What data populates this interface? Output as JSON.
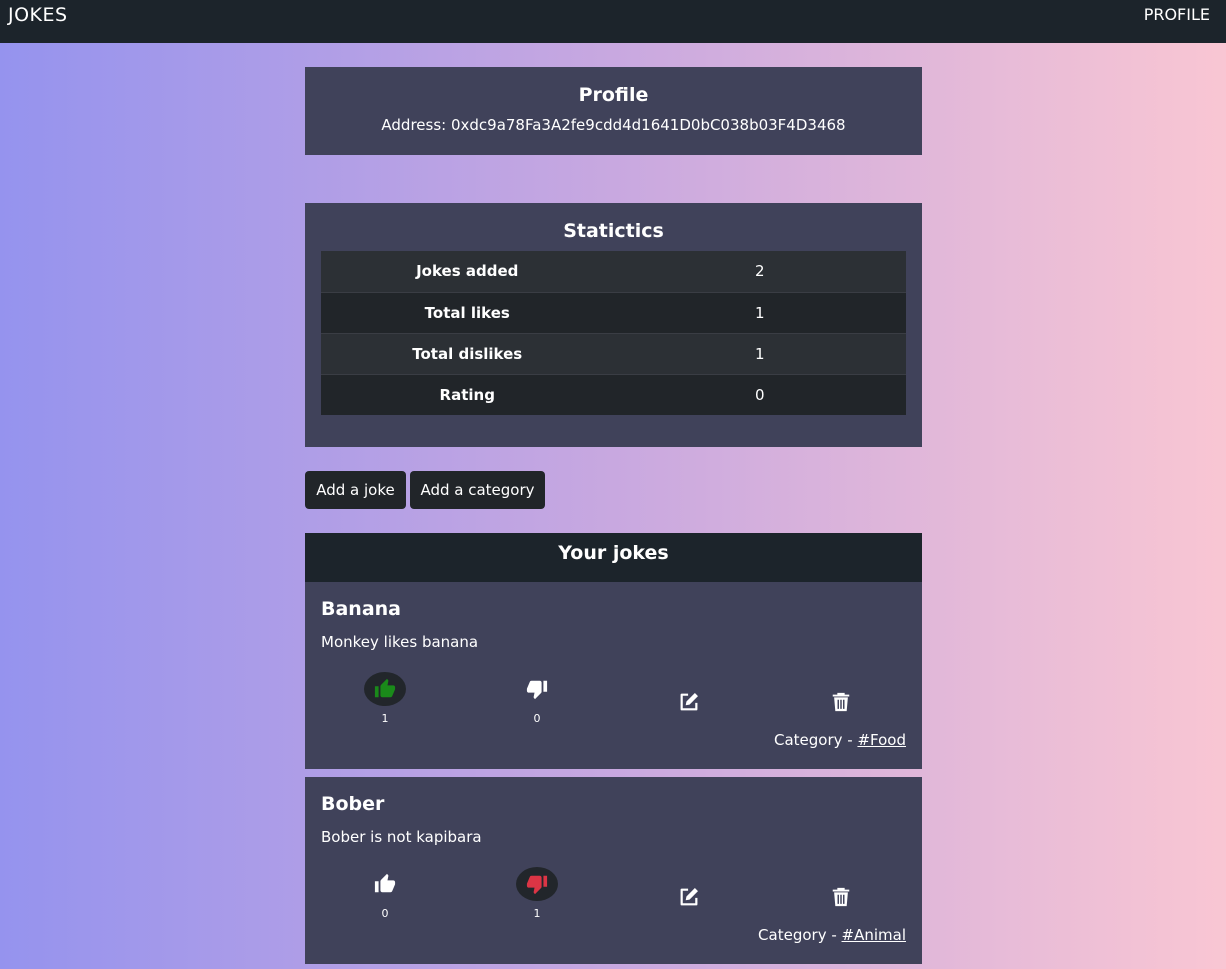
{
  "nav": {
    "brand": "JOKES",
    "profile_link": "PROFILE"
  },
  "profile": {
    "title": "Profile",
    "address": "Address: 0xdc9a78Fa3A2fe9cdd4d1641D0bC038b03F4D3468"
  },
  "statistics": {
    "title": "Statictics",
    "rows": [
      {
        "label": "Jokes added",
        "value": "2"
      },
      {
        "label": "Total likes",
        "value": "1"
      },
      {
        "label": "Total dislikes",
        "value": "1"
      },
      {
        "label": "Rating",
        "value": "0"
      }
    ]
  },
  "actions": {
    "add_joke": "Add a joke",
    "add_category": "Add a category"
  },
  "jokes_section": {
    "title": "Your jokes",
    "category_prefix": "Category - ",
    "items": [
      {
        "title": "Banana",
        "text": "Monkey likes banana",
        "likes": "1",
        "dislikes": "0",
        "liked": true,
        "disliked": false,
        "category": "#Food"
      },
      {
        "title": "Bober",
        "text": "Bober is not kapibara",
        "likes": "0",
        "dislikes": "1",
        "liked": false,
        "disliked": true,
        "category": "#Animal"
      }
    ]
  },
  "colors": {
    "like_active": "#1a8a1a",
    "dislike_active": "#dc3545",
    "panel": "#40425a",
    "navbar": "#1c242b"
  },
  "icons": {
    "like": "thumbs-up-icon",
    "dislike": "thumbs-down-icon",
    "edit": "edit-icon",
    "delete": "trash-icon"
  }
}
